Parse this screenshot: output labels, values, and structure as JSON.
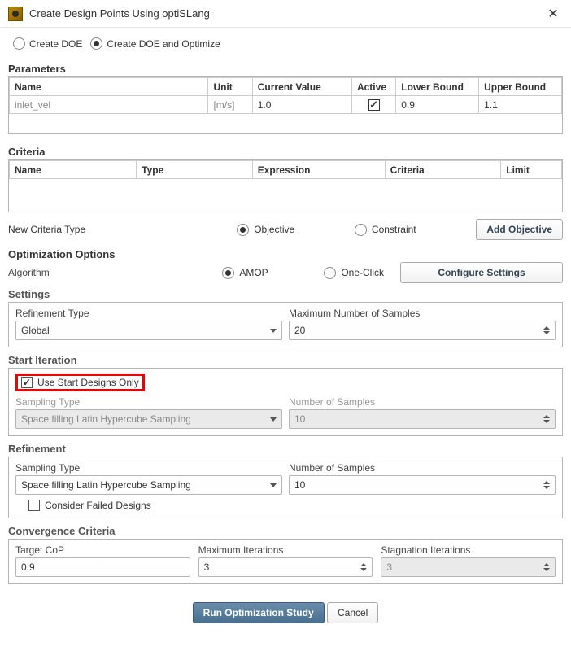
{
  "window": {
    "title": "Create Design Points Using optiSLang"
  },
  "mode": {
    "opt1": "Create DOE",
    "opt2": "Create DOE and Optimize",
    "selected": 2
  },
  "parameters": {
    "title": "Parameters",
    "headers": [
      "Name",
      "Unit",
      "Current Value",
      "Active",
      "Lower Bound",
      "Upper Bound"
    ],
    "row": {
      "name": "inlet_vel",
      "unit": "[m/s]",
      "cur": "1.0",
      "active": true,
      "lo": "0.9",
      "hi": "1.1"
    }
  },
  "criteria": {
    "title": "Criteria",
    "headers": [
      "Name",
      "Type",
      "Expression",
      "Criteria",
      "Limit"
    ],
    "new_label": "New Criteria Type",
    "obj": "Objective",
    "con": "Constraint",
    "add": "Add Objective"
  },
  "opt": {
    "title": "Optimization Options",
    "algo_label": "Algorithm",
    "amop": "AMOP",
    "oneclick": "One-Click",
    "cfg": "Configure Settings",
    "settings_label": "Settings",
    "refine_type": "Refinement Type",
    "refine_val": "Global",
    "max_samp": "Maximum Number of Samples",
    "max_samp_val": "20",
    "start_it": "Start Iteration",
    "use_start": "Use Start Designs Only",
    "samp_type": "Sampling Type",
    "samp_val": "Space filling Latin Hypercube Sampling",
    "num_samp": "Number of Samples",
    "num_samp_val": "10",
    "refinement": "Refinement",
    "num_samp_val2": "10",
    "consider_failed": "Consider Failed Designs",
    "conv": "Convergence Criteria",
    "tcop": "Target CoP",
    "tcop_val": "0.9",
    "maxit": "Maximum Iterations",
    "maxit_val": "3",
    "stag": "Stagnation Iterations",
    "stag_val": "3"
  },
  "footer": {
    "run": "Run Optimization Study",
    "cancel": "Cancel"
  }
}
